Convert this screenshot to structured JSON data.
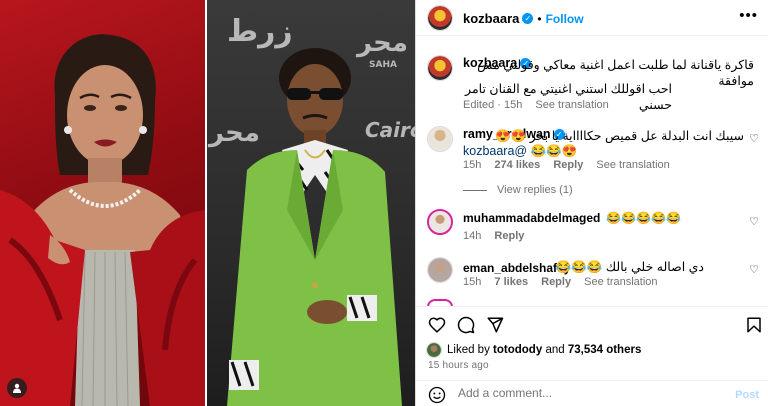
{
  "media": {
    "backdrop_logo_1": "زرط",
    "backdrop_logo_2": "محر",
    "backdrop_logo_3": "SAHA",
    "backdrop_logo_4": "Cairo"
  },
  "post": {
    "author": "kozbaara",
    "follow_label": "Follow",
    "caption_line1": "قاكرة ياقنانة لما طلبت اعمل اغنية معاكي وقولتي مش موافقة",
    "caption_line2": "احب اقوللك استني اغنيتي مع القنان تامر حسني",
    "caption_edited": "Edited · 15h",
    "caption_see_translation": "See translation"
  },
  "comments": [
    {
      "username": "ramy__radwan",
      "text": "سيبك انت البدلة عل قميص حكااااية يا بحر 😍😍",
      "mention": "kozbaara@",
      "emojis": "😂😂😍",
      "time": "15h",
      "likes": "274 likes",
      "reply": "Reply",
      "translation": "See translation",
      "view_replies": "View replies (1)"
    },
    {
      "username": "muhammadabdelmaged",
      "text": "😂😂😂😂😂",
      "time": "14h",
      "reply": "Reply"
    },
    {
      "username": "eman_abdelshafey",
      "text": "دي اصاله خلي بالك 😂😂😂",
      "time": "15h",
      "likes": "7 likes",
      "reply": "Reply",
      "translation": "See translation"
    }
  ],
  "liked_by": {
    "prefix": "Liked by",
    "user": "totodody",
    "and": "and",
    "count": "73,534 others"
  },
  "timestamp": "15 hours ago",
  "add_comment": {
    "placeholder": "Add a comment...",
    "post_label": "Post"
  },
  "colors": {
    "accent": "#0095f6",
    "muted": "#737373",
    "post_disabled": "#b3dbff"
  }
}
